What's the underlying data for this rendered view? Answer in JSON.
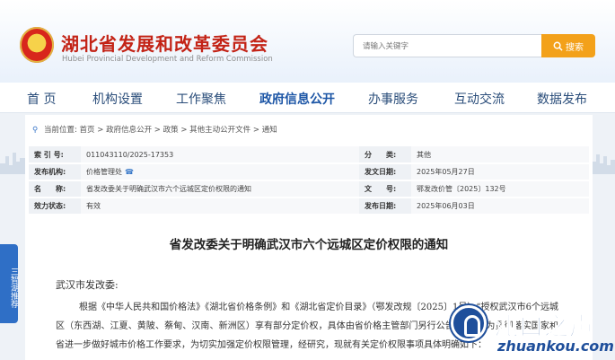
{
  "header": {
    "site_name_cn": "湖北省发展和改革委员会",
    "site_name_en": "Hubei Provincial Development and Reform Commission",
    "search": {
      "placeholder": "请输入关键字",
      "button_label": "搜索"
    }
  },
  "nav": {
    "items": [
      {
        "label": "首 页"
      },
      {
        "label": "机构设置"
      },
      {
        "label": "工作聚焦"
      },
      {
        "label": "政府信息公开",
        "active": true
      },
      {
        "label": "办事服务"
      },
      {
        "label": "互动交流"
      },
      {
        "label": "数据发布"
      }
    ]
  },
  "side_banner": {
    "label": "三智湖推荐"
  },
  "breadcrumb": {
    "prefix": "当前位置:",
    "path": [
      "首页",
      "政府信息公开",
      "政策",
      "其他主动公开文件",
      "通知"
    ],
    "separator": ">"
  },
  "meta": {
    "rows": [
      {
        "k1": "索 引 号:",
        "v1": "011043110/2025-17353",
        "k2": "分　　类:",
        "v2": "其他"
      },
      {
        "k1": "发布机构:",
        "v1": "价格管理处",
        "k2": "发文日期:",
        "v2": "2025年05月27日"
      },
      {
        "k1": "名　　称:",
        "v1": "省发改委关于明确武汉市六个远城区定价权限的通知",
        "k2": "文　　号:",
        "v2": "鄂发改价管〔2025〕132号"
      },
      {
        "k1": "效力状态:",
        "v1": "有效",
        "k2": "发布日期:",
        "v2": "2025年06月03日"
      }
    ]
  },
  "document": {
    "title": "省发改委关于明确武汉市六个远城区定价权限的通知",
    "salutation": "武汉市发改委:",
    "body": "根据《中华人民共和国价格法》《湖北省价格条例》和《湖北省定价目录》（鄂发改规〔2025〕1号）“授权武汉市6个远城区（东西湖、江夏、黄陂、蔡甸、汉南、新洲区）享有部分定价权，具体由省价格主管部门另行公告”规定，为贯彻落实国家和省进一步做好城市价格工作要求，为切实加强定价权限管理，经研究，现就有关定价权限事项具体明确如下："
  },
  "watermark": {
    "cn": "沌口之声",
    "en": "zhuankou.com"
  },
  "colors": {
    "brand_red": "#c32316",
    "nav_blue": "#2a4d7a",
    "search_orange": "#f3a11a",
    "watermark_blue": "#1f4f9b"
  }
}
